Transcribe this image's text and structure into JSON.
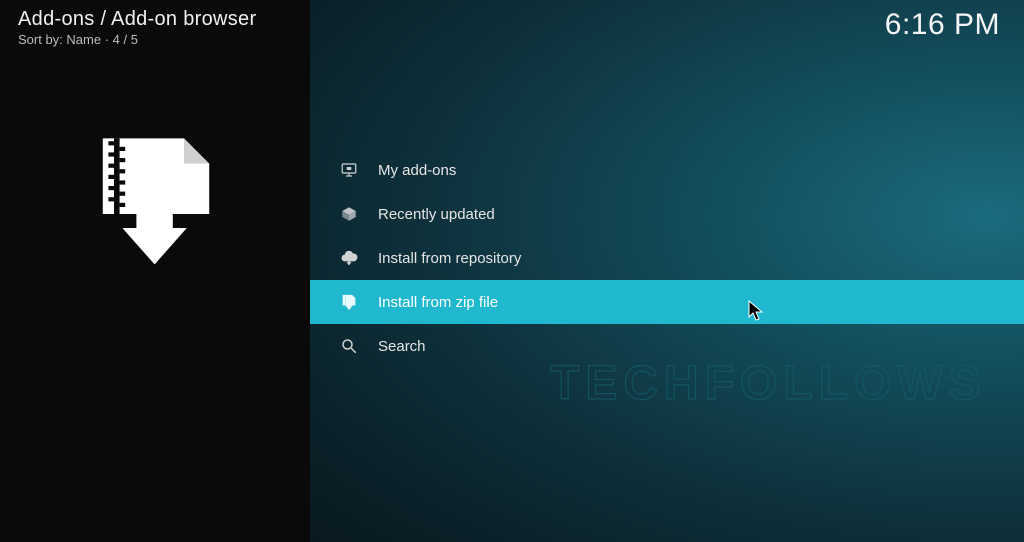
{
  "header": {
    "breadcrumb": "Add-ons / Add-on browser",
    "sort_line": "Sort by: Name  ·  4 / 5",
    "clock": "6:16 PM"
  },
  "menu": {
    "items": [
      {
        "icon": "screen-icon",
        "label": "My add-ons",
        "selected": false
      },
      {
        "icon": "box-open-icon",
        "label": "Recently updated",
        "selected": false
      },
      {
        "icon": "cloud-download-icon",
        "label": "Install from repository",
        "selected": false
      },
      {
        "icon": "zip-download-icon",
        "label": "Install from zip file",
        "selected": true
      },
      {
        "icon": "search-icon",
        "label": "Search",
        "selected": false
      }
    ]
  },
  "sidebar": {
    "hero_icon": "zip-file-download-icon"
  },
  "watermark": "TECHFOLLOWS"
}
